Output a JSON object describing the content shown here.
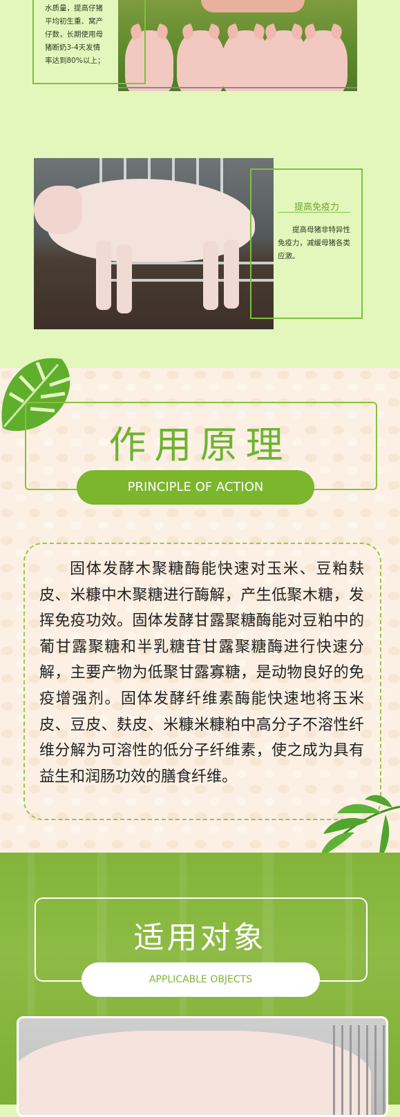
{
  "benefit1": {
    "text": "水质量，提高仔猪\n平均初生重、窝产\n仔数，长期使用母\n猪断奶3-4天发情\n率达到80%以上；"
  },
  "benefit2": {
    "title": "提高免疫力",
    "text": "提高母猪非特异性免疫力，减缓母猪各类应激。"
  },
  "principle": {
    "title": "作用原理",
    "subtitle": "PRINCIPLE OF ACTION",
    "body": "固体发酵木聚糖酶能快速对玉米、豆粕麸皮、米糠中木聚糖进行酶解，产生低聚木糖，发挥免疫功效。固体发酵甘露聚糖酶能对豆粕中的葡甘露聚糖和半乳糖苷甘露聚糖酶进行快速分解，主要产物为低聚甘露寡糖，是动物良好的免疫增强剂。固体发酵纤维素酶能快速地将玉米皮、豆皮、麸皮、米糠米糠粕中高分子不溶性纤维分解为可溶性的低分子纤维素，使之成为具有益生和润肠功效的膳食纤维。"
  },
  "objects": {
    "title": "适用对象",
    "subtitle": "APPLICABLE OBJECTS"
  },
  "colors": {
    "light_green_bg": "#e3f7bd",
    "accent_green": "#7bb62d",
    "frame_green": "#7cc23a"
  }
}
